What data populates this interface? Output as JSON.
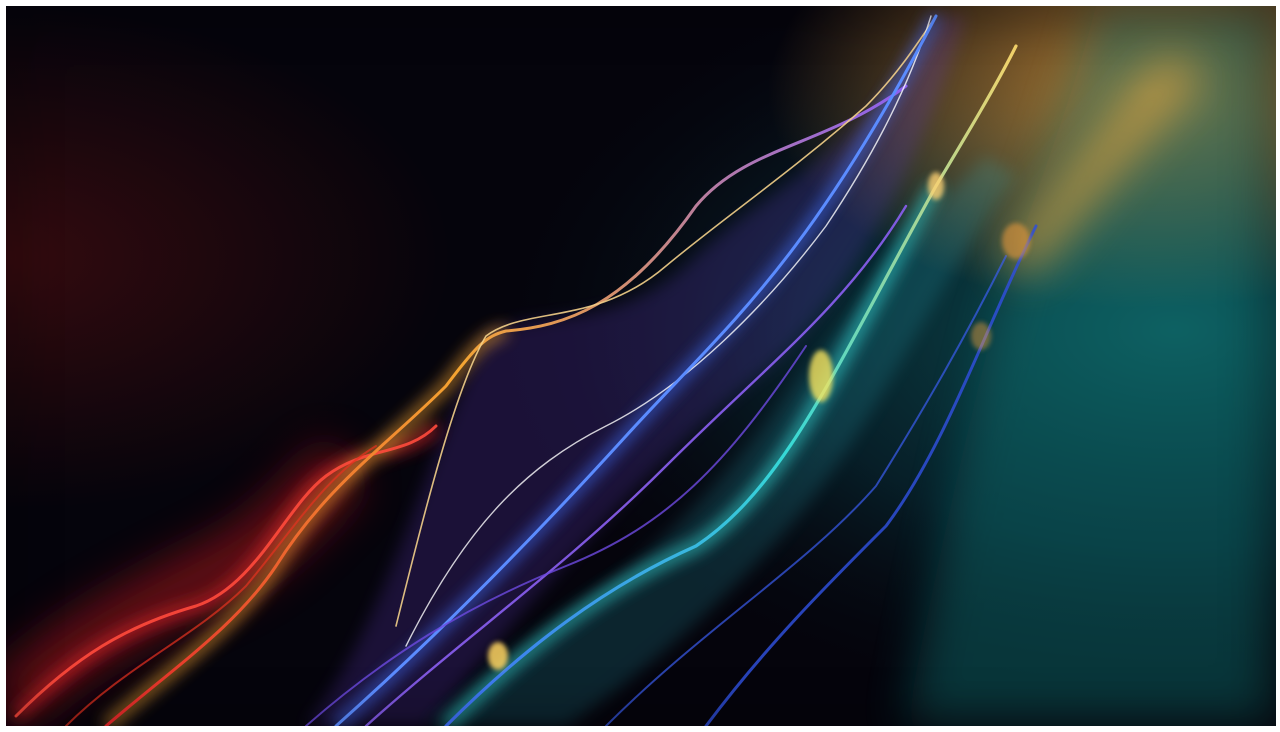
{
  "image": {
    "alt": "",
    "palette": {
      "background": "#05040c",
      "red": "#e4262a",
      "orange": "#f5a531",
      "violet": "#8b5ff2",
      "blue": "#3f6cf5",
      "cyan": "#36d9d6",
      "teal": "#0d5c5e"
    }
  }
}
